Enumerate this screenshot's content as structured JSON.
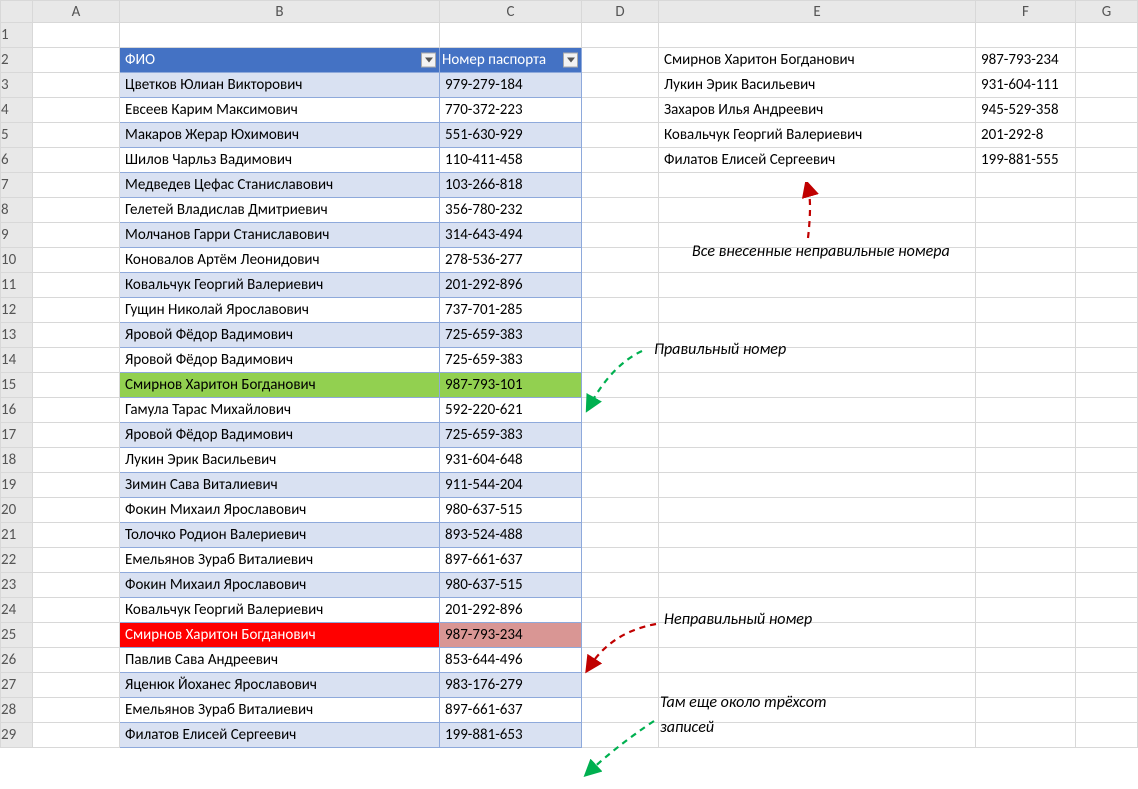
{
  "columns": [
    "A",
    "B",
    "C",
    "D",
    "E",
    "F",
    "G"
  ],
  "row_count": 29,
  "table": {
    "header": {
      "fio": "ФИО",
      "passport": "Номер паспорта"
    },
    "rows": [
      {
        "fio": "Цветков Юлиан Викторович",
        "num": "979-279-184",
        "state": "normal"
      },
      {
        "fio": "Евсеев Карим Максимович",
        "num": "770-372-223",
        "state": "normal"
      },
      {
        "fio": "Макаров Жерар Юхимович",
        "num": "551-630-929",
        "state": "normal"
      },
      {
        "fio": "Шилов Чарльз Вадимович",
        "num": "110-411-458",
        "state": "normal"
      },
      {
        "fio": "Медведев Цефас Станиславович",
        "num": "103-266-818",
        "state": "normal"
      },
      {
        "fio": "Гелетей Владислав Дмитриевич",
        "num": "356-780-232",
        "state": "normal"
      },
      {
        "fio": "Молчанов Гарри Станиславович",
        "num": "314-643-494",
        "state": "normal"
      },
      {
        "fio": "Коновалов Артём Леонидович",
        "num": "278-536-277",
        "state": "normal"
      },
      {
        "fio": "Ковальчук Георгий Валериевич",
        "num": "201-292-896",
        "state": "normal"
      },
      {
        "fio": "Гущин Николай Ярославович",
        "num": "737-701-285",
        "state": "normal"
      },
      {
        "fio": "Яровой Фёдор Вадимович",
        "num": "725-659-383",
        "state": "normal"
      },
      {
        "fio": "Яровой Фёдор Вадимович",
        "num": "725-659-383",
        "state": "normal"
      },
      {
        "fio": "Смирнов Харитон Богданович",
        "num": "987-793-101",
        "state": "green"
      },
      {
        "fio": "Гамула Тарас Михайлович",
        "num": "592-220-621",
        "state": "normal"
      },
      {
        "fio": "Яровой Фёдор Вадимович",
        "num": "725-659-383",
        "state": "normal"
      },
      {
        "fio": "Лукин Эрик Васильевич",
        "num": "931-604-648",
        "state": "normal"
      },
      {
        "fio": "Зимин Сава Виталиевич",
        "num": "911-544-204",
        "state": "normal"
      },
      {
        "fio": "Фокин Михаил Ярославович",
        "num": "980-637-515",
        "state": "normal"
      },
      {
        "fio": "Толочко Родион Валериевич",
        "num": "893-524-488",
        "state": "normal"
      },
      {
        "fio": "Емельянов Зураб Виталиевич",
        "num": "897-661-637",
        "state": "normal"
      },
      {
        "fio": "Фокин Михаил Ярославович",
        "num": "980-637-515",
        "state": "normal"
      },
      {
        "fio": "Ковальчук Георгий Валериевич",
        "num": "201-292-896",
        "state": "normal"
      },
      {
        "fio": "Смирнов Харитон Богданович",
        "num": "987-793-234",
        "state": "red"
      },
      {
        "fio": "Павлив Сава Андреевич",
        "num": "853-644-496",
        "state": "normal"
      },
      {
        "fio": "Яценюк Йоханес Ярославович",
        "num": "983-176-279",
        "state": "normal"
      },
      {
        "fio": "Емельянов Зураб Виталиевич",
        "num": "897-661-637",
        "state": "normal"
      },
      {
        "fio": "Филатов Елисей Сергеевич",
        "num": "199-881-653",
        "state": "normal"
      }
    ]
  },
  "wrong_list": [
    {
      "fio": "Смирнов Харитон Богданович",
      "num": "987-793-234"
    },
    {
      "fio": "Лукин Эрик Васильевич",
      "num": "931-604-111"
    },
    {
      "fio": "Захаров Илья Андреевич",
      "num": "945-529-358"
    },
    {
      "fio": "Ковальчук Георгий Валериевич",
      "num": "201-292-8"
    },
    {
      "fio": "Филатов Елисей Сергеевич",
      "num": "199-881-555"
    }
  ],
  "annotations": {
    "all_wrong": "Все внесенные неправильные номера",
    "correct": "Правильный номер",
    "wrong": "Неправильный номер",
    "more1": "Там еще около трёхсот",
    "more2": "записей"
  }
}
